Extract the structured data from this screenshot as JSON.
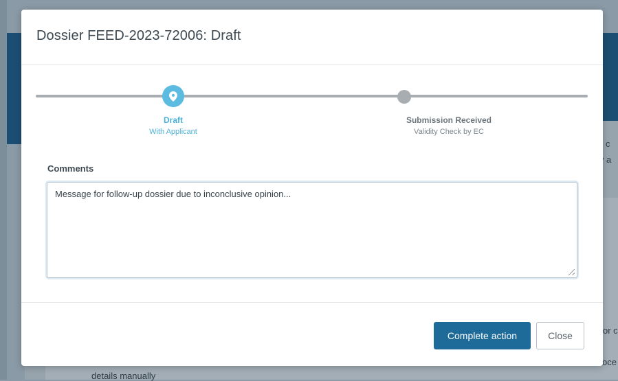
{
  "background": {
    "right_text_1": "r c",
    "right_text_2": "ly a",
    "right_text_3": "or c",
    "right_text_4": "oce",
    "bottom_text": "details manually"
  },
  "modal": {
    "title": "Dossier FEED-2023-72006: Draft",
    "stepper": {
      "steps": [
        {
          "title": "Draft",
          "subtitle": "With Applicant",
          "state": "active"
        },
        {
          "title": "Submission Received",
          "subtitle": "Validity Check by EC",
          "state": "inactive"
        }
      ]
    },
    "comments": {
      "label": "Comments",
      "value": "Message for follow-up dossier due to inconclusive opinion..."
    },
    "footer": {
      "primary_label": "Complete action",
      "secondary_label": "Close"
    }
  },
  "colors": {
    "accent": "#5bbbe0",
    "primary_button": "#1e6b9a",
    "header_band": "#1c4e73"
  }
}
